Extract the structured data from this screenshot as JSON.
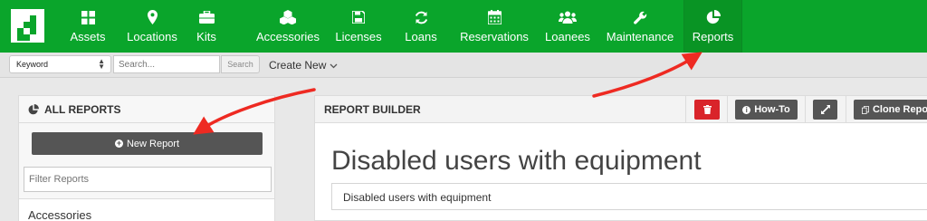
{
  "nav": {
    "items": [
      {
        "label": "Assets",
        "icon": "grid-icon"
      },
      {
        "label": "Locations",
        "icon": "map-pin-icon"
      },
      {
        "label": "Kits",
        "icon": "briefcase-icon"
      },
      {
        "label": "Accessories",
        "icon": "cubes-icon"
      },
      {
        "label": "Licenses",
        "icon": "floppy-disk-icon"
      },
      {
        "label": "Loans",
        "icon": "refresh-icon"
      },
      {
        "label": "Reservations",
        "icon": "calendar-icon"
      },
      {
        "label": "Loanees",
        "icon": "users-icon"
      },
      {
        "label": "Maintenance",
        "icon": "wrench-icon"
      },
      {
        "label": "Reports",
        "icon": "pie-chart-icon"
      }
    ],
    "active": "Reports",
    "color": "#0aa52b"
  },
  "search": {
    "scope_select": "Keyword",
    "placeholder": "Search...",
    "button_label": "Search",
    "create_new_label": "Create New"
  },
  "left_panel": {
    "title": "ALL REPORTS",
    "new_report_label": "New Report",
    "filter_placeholder": "Filter Reports",
    "first_group": "Accessories"
  },
  "right_panel": {
    "title": "REPORT BUILDER",
    "howto_label": "How-To",
    "clone_label": "Clone Report",
    "report_title": "Disabled users with equipment",
    "report_name_value": "Disabled users with equipment",
    "delete_color": "#d9242a"
  },
  "annotation": {
    "arrow_color": "#ee2a22"
  }
}
